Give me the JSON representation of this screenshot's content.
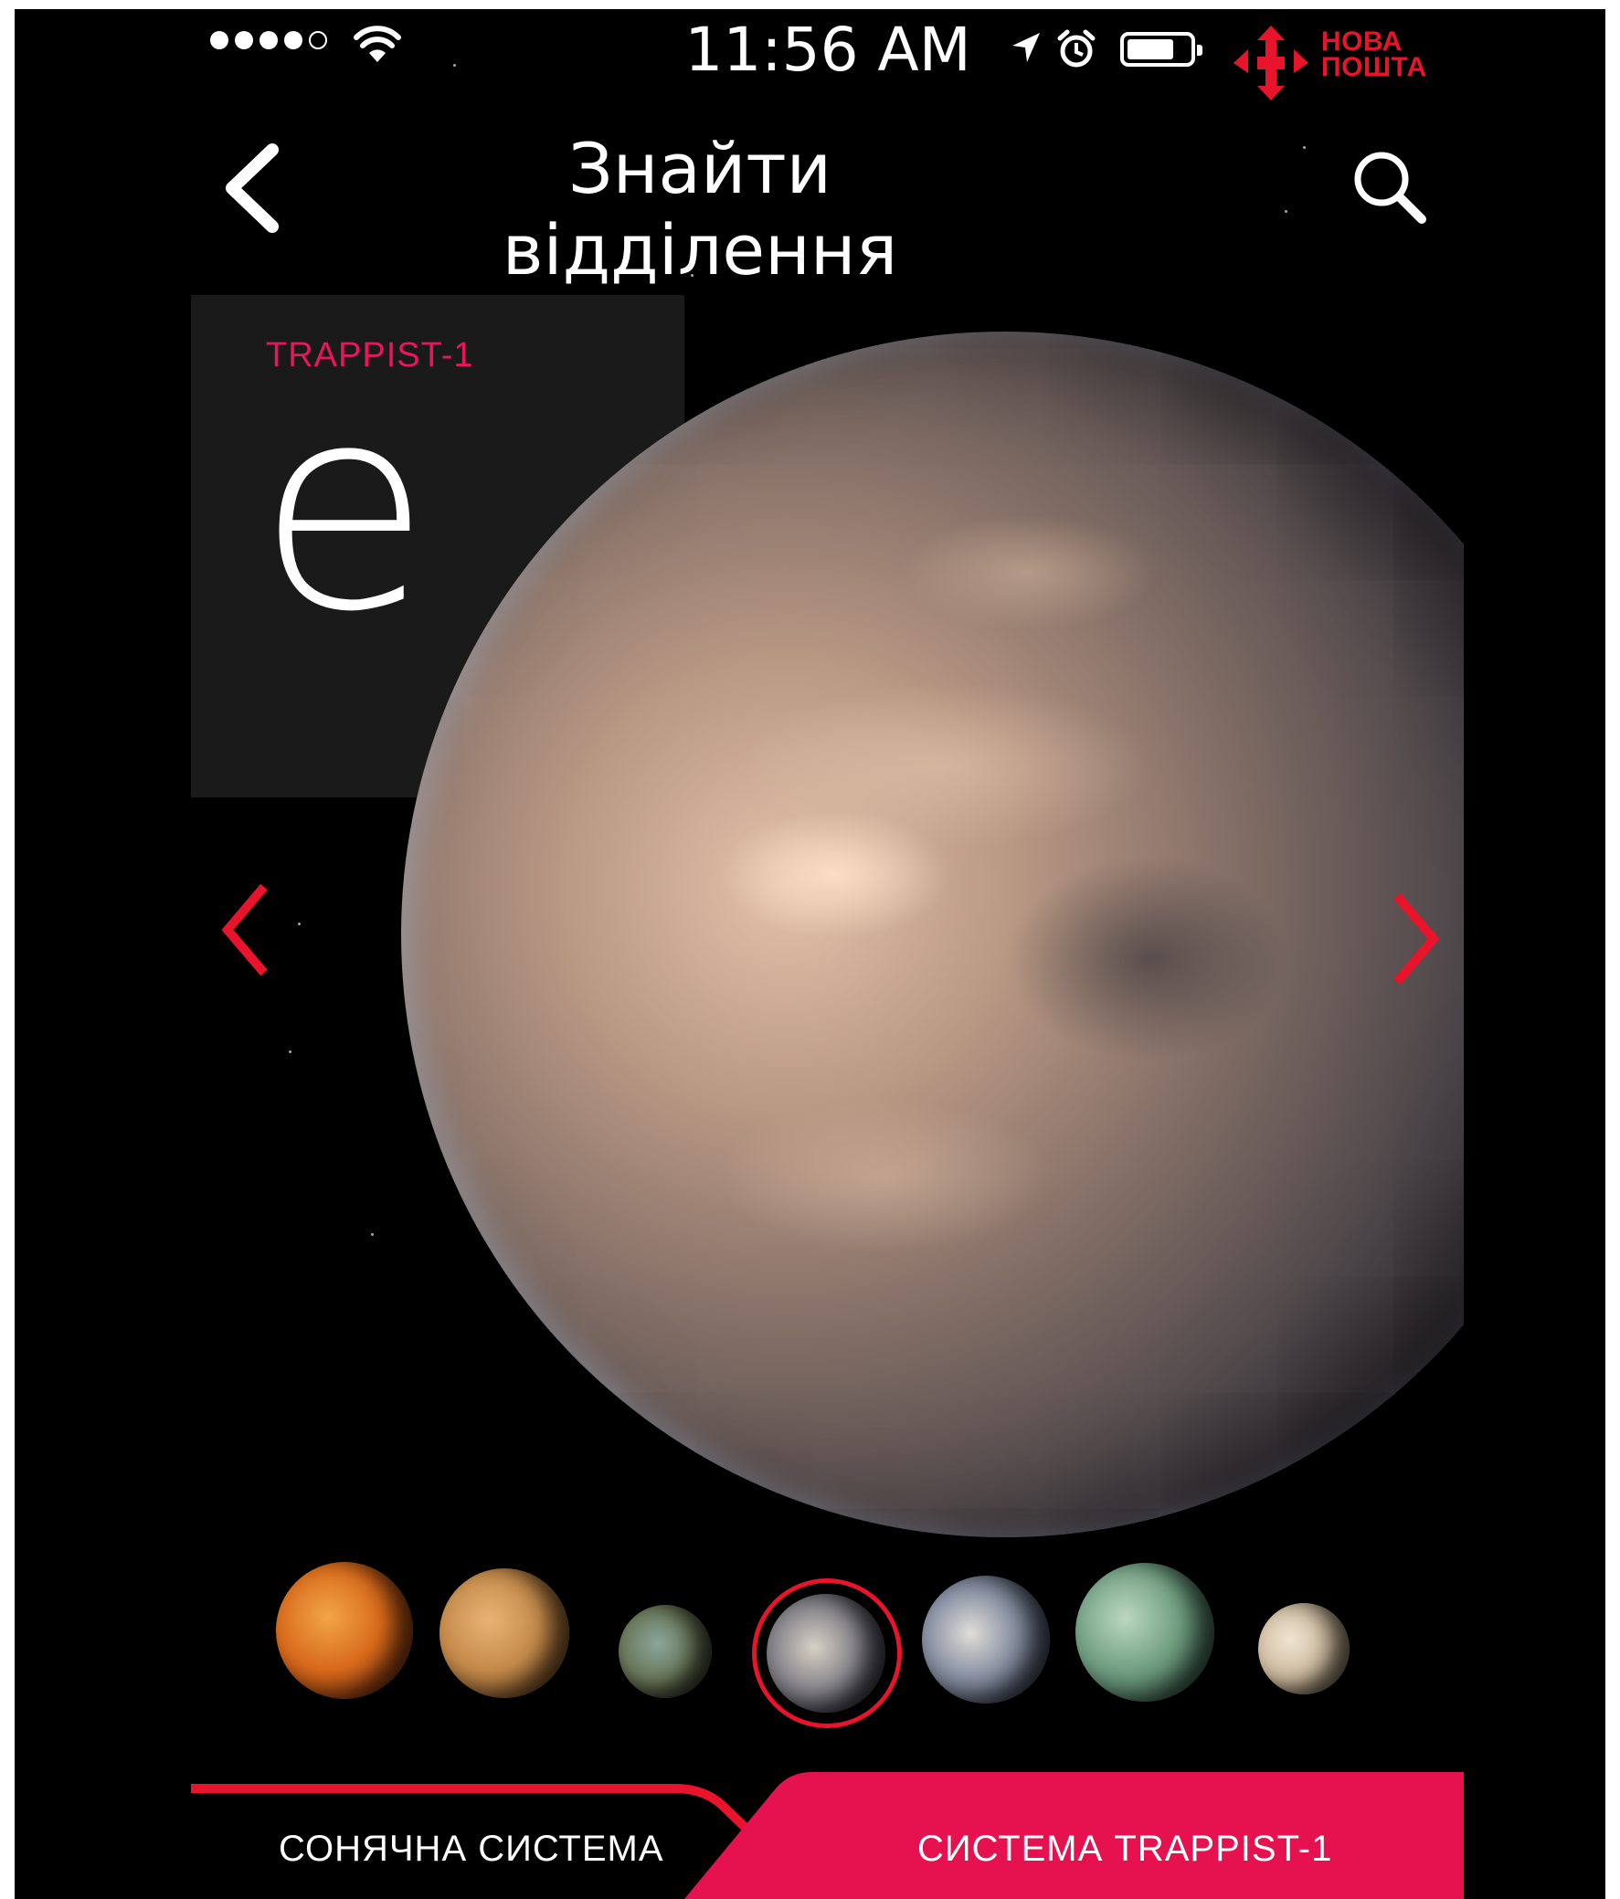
{
  "status_bar": {
    "time": "11:56 AM",
    "brand": [
      "НОВА",
      "ПОШТА"
    ]
  },
  "nav": {
    "title": "Знайти відділення",
    "back_icon": "chevron-left-icon",
    "search_icon": "search-icon"
  },
  "hero": {
    "system": "TRAPPIST-1",
    "planet_letter": "e"
  },
  "planets": [
    "b",
    "c",
    "d",
    "e",
    "f",
    "g",
    "h"
  ],
  "selected_planet": "e",
  "tabs": [
    {
      "label": "СОНЯЧНА СИСТЕМА",
      "active": false
    },
    {
      "label": "СИСТЕМА TRAPPIST-1",
      "active": true
    }
  ],
  "colors": {
    "accent": "#e8142c",
    "accent_pink": "#e4185a",
    "background": "#000000"
  }
}
